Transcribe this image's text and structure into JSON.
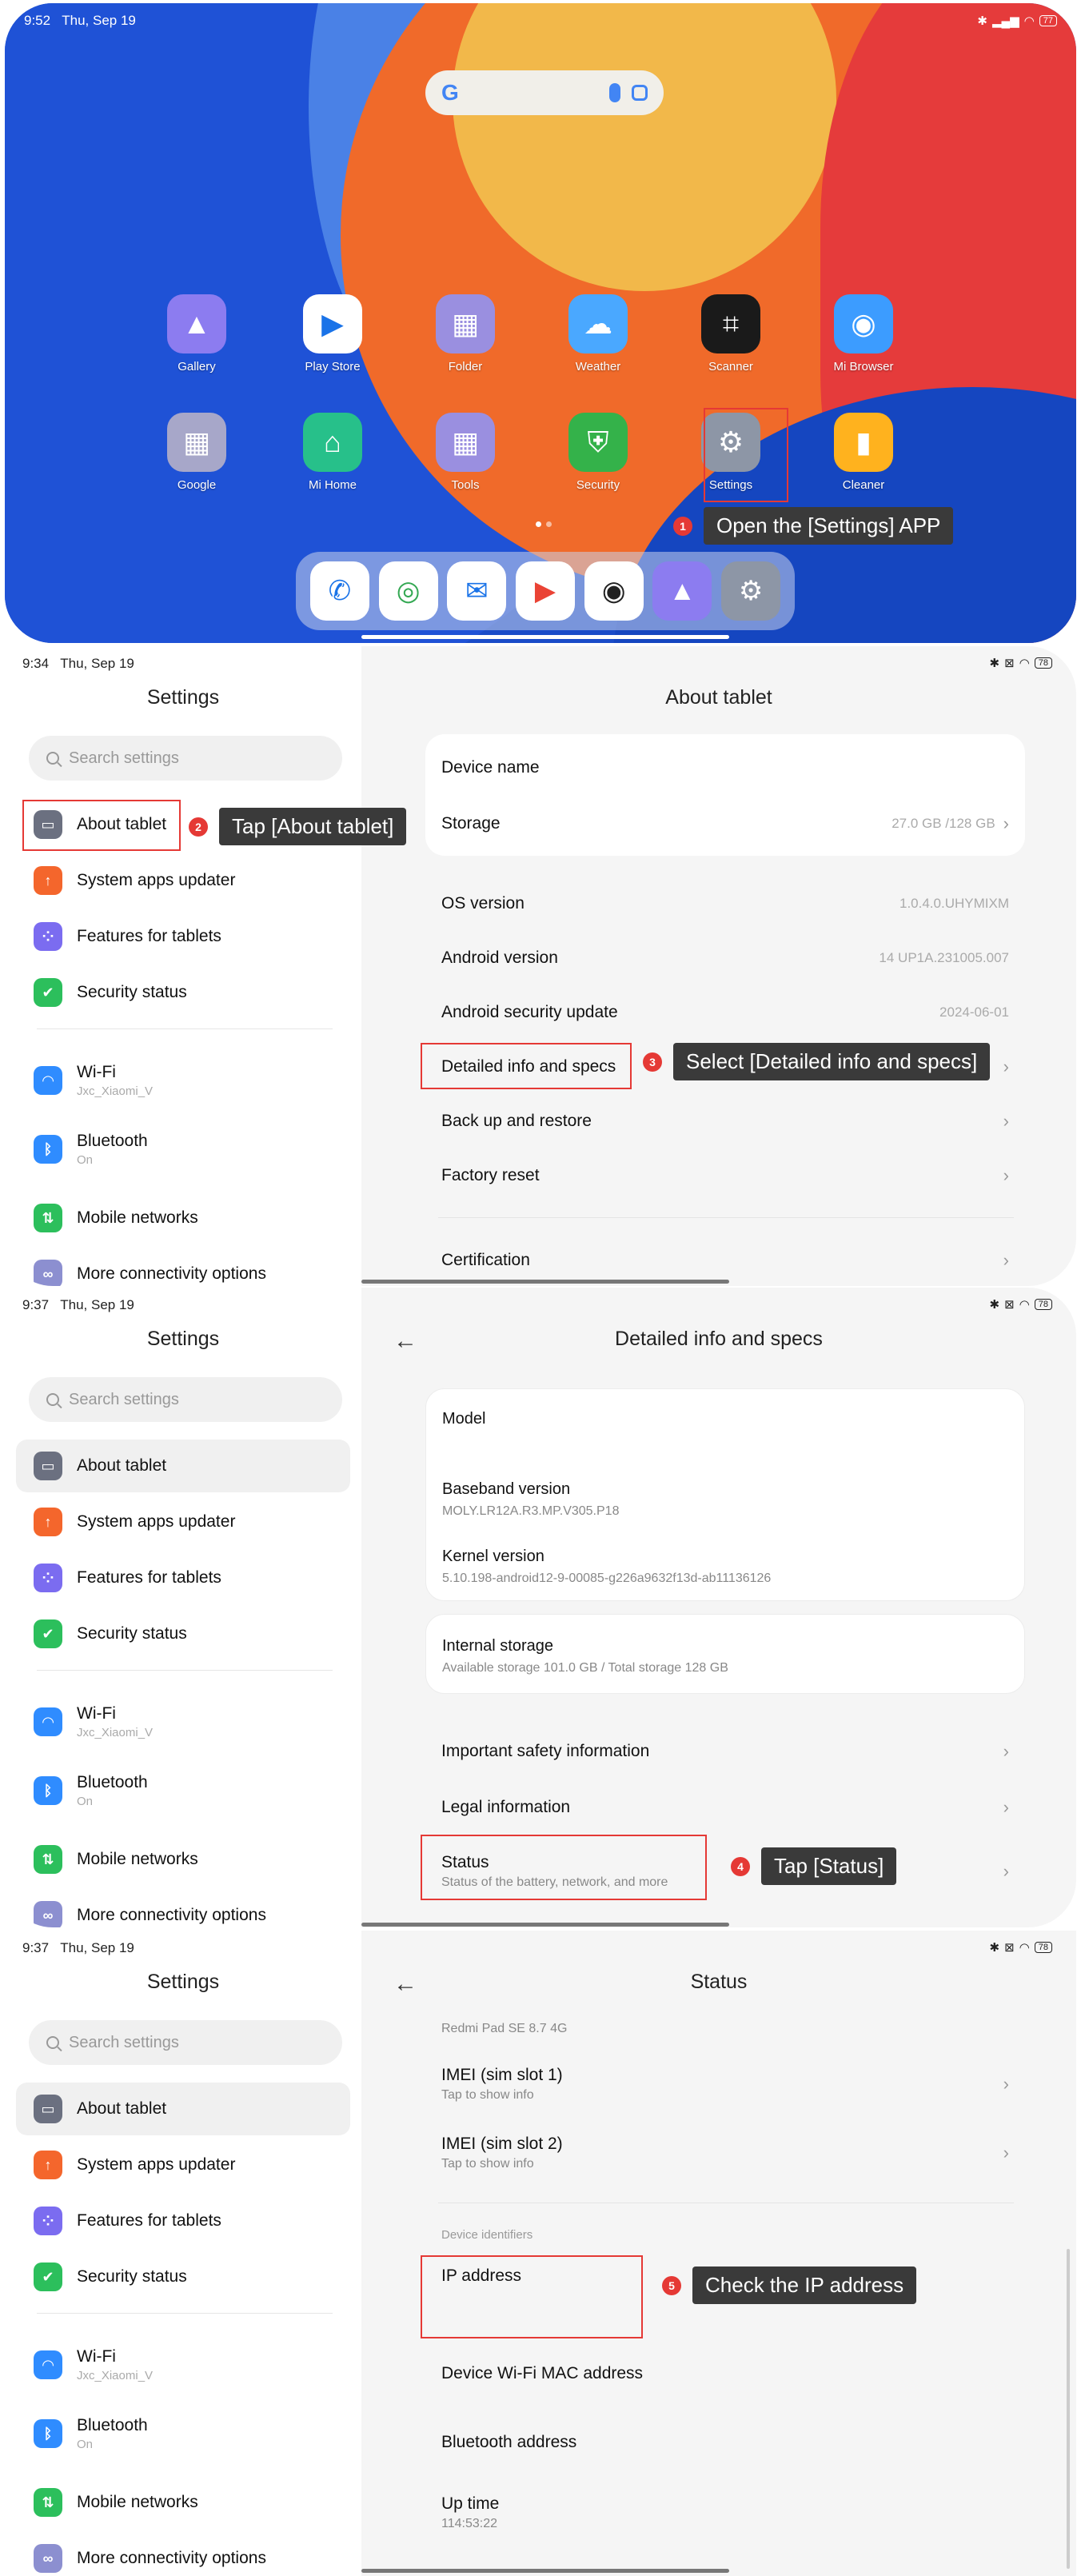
{
  "home": {
    "time": "9:52",
    "date": "Thu, Sep 19",
    "battery": "77",
    "apps_row1": [
      {
        "label": "Gallery",
        "icon": "gallery-icon",
        "color": "#8c7cf0"
      },
      {
        "label": "Play Store",
        "icon": "play-store-icon",
        "color": "#ffffff"
      },
      {
        "label": "Folder",
        "icon": "folder-icon",
        "color": "#9a8fe0"
      },
      {
        "label": "Weather",
        "icon": "weather-icon",
        "color": "#4aa8ff"
      },
      {
        "label": "Scanner",
        "icon": "scanner-icon",
        "color": "#1a1a1a"
      },
      {
        "label": "Mi Browser",
        "icon": "browser-icon",
        "color": "#3c9cff"
      }
    ],
    "apps_row2": [
      {
        "label": "Google",
        "icon": "google-folder-icon",
        "color": "#a7a7c9"
      },
      {
        "label": "Mi Home",
        "icon": "mi-home-icon",
        "color": "#27c08a"
      },
      {
        "label": "Tools",
        "icon": "tools-folder-icon",
        "color": "#9a8fe0"
      },
      {
        "label": "Security",
        "icon": "security-icon",
        "color": "#34b24a"
      },
      {
        "label": "Settings",
        "icon": "settings-icon",
        "color": "#8d96a6"
      },
      {
        "label": "Cleaner",
        "icon": "cleaner-icon",
        "color": "#ffb21e"
      }
    ],
    "dock": [
      {
        "icon": "phone-icon",
        "color": "#ffffff"
      },
      {
        "icon": "chrome-icon",
        "color": "#ffffff"
      },
      {
        "icon": "messages-icon",
        "color": "#ffffff"
      },
      {
        "icon": "play-icon",
        "color": "#ffffff"
      },
      {
        "icon": "camera-icon",
        "color": "#ffffff"
      },
      {
        "icon": "gallery-icon",
        "color": "#8c7cf0"
      },
      {
        "icon": "settings-icon",
        "color": "#8d96a6"
      }
    ],
    "step1": {
      "num": "1",
      "text": "Open the [Settings] APP"
    }
  },
  "settings_nav": {
    "title": "Settings",
    "search_placeholder": "Search settings",
    "items": [
      {
        "label": "About tablet",
        "icon": "tablet-icon",
        "color": "#6b7080"
      },
      {
        "label": "System apps updater",
        "icon": "arrow-up-icon",
        "color": "#f4662c"
      },
      {
        "label": "Features for tablets",
        "icon": "grid-icon",
        "color": "#7b6cf0"
      },
      {
        "label": "Security status",
        "icon": "shield-icon",
        "color": "#2cbf5c"
      },
      {
        "label": "Wi-Fi",
        "sub": "Jxc_Xiaomi_V",
        "icon": "wifi-icon",
        "color": "#2f8cff"
      },
      {
        "label": "Bluetooth",
        "sub": "On",
        "icon": "bluetooth-icon",
        "color": "#2f8cff"
      },
      {
        "label": "Mobile networks",
        "icon": "mobile-data-icon",
        "color": "#2cbf5c"
      },
      {
        "label": "More connectivity options",
        "icon": "link-icon",
        "color": "#8c8fd0"
      }
    ]
  },
  "about": {
    "time": "9:34",
    "date": "Thu, Sep 19",
    "title": "About tablet",
    "device_name": "Device name",
    "storage": {
      "label": "Storage",
      "value": "27.0 GB /128 GB"
    },
    "rows": [
      {
        "label": "OS version",
        "value": "1.0.4.0.UHYMIXM"
      },
      {
        "label": "Android version",
        "value": "14 UP1A.231005.007"
      },
      {
        "label": "Android security update",
        "value": "2024-06-01"
      },
      {
        "label": "Detailed info and specs",
        "value": ""
      },
      {
        "label": "Back up and restore",
        "value": ""
      },
      {
        "label": "Factory reset",
        "value": ""
      },
      {
        "label": "Certification",
        "value": ""
      }
    ],
    "step2": {
      "num": "2",
      "text": "Tap [About tablet]"
    },
    "step3": {
      "num": "3",
      "text": "Select [Detailed info and specs]"
    }
  },
  "specs": {
    "time": "9:37",
    "date": "Thu, Sep 19",
    "title": "Detailed info and specs",
    "model": "Model",
    "baseband": {
      "label": "Baseband version",
      "value": "MOLY.LR12A.R3.MP.V305.P18"
    },
    "kernel": {
      "label": "Kernel version",
      "value": "5.10.198-android12-9-00085-g226a9632f13d-ab11136126"
    },
    "internal": {
      "label": "Internal storage",
      "value": "Available storage  101.0 GB / Total storage  128 GB"
    },
    "safety": "Important safety information",
    "legal": "Legal information",
    "status": {
      "label": "Status",
      "sub": "Status of the battery, network, and more"
    },
    "step4": {
      "num": "4",
      "text": "Tap [Status]"
    }
  },
  "status": {
    "time": "9:37",
    "date": "Thu, Sep 19",
    "title": "Status",
    "model_line": "Redmi Pad SE 8.7 4G",
    "imei1": {
      "label": "IMEI (sim slot 1)",
      "sub": "Tap to show info"
    },
    "imei2": {
      "label": "IMEI (sim slot 2)",
      "sub": "Tap to show info"
    },
    "section": "Device identifiers",
    "ip": "IP address",
    "mac": "Device Wi-Fi MAC address",
    "bt": "Bluetooth address",
    "uptime": {
      "label": "Up time",
      "value": "114:53:22"
    },
    "step5": {
      "num": "5",
      "text": "Check the IP address"
    }
  }
}
